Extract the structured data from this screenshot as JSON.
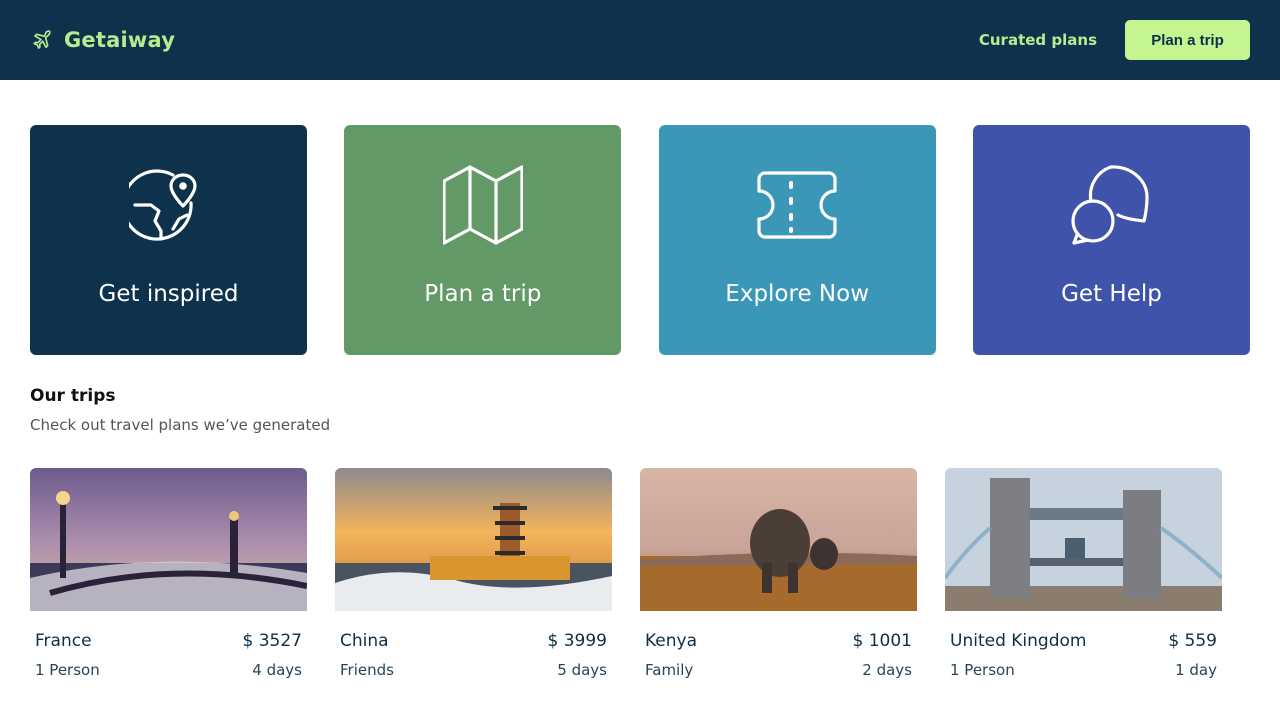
{
  "header": {
    "brand": "Getaiway",
    "nav_link": "Curated plans",
    "cta": "Plan a trip",
    "logo_icon": "airplane-icon"
  },
  "tiles": [
    {
      "label": "Get inspired",
      "icon": "globe-pin-icon",
      "color": "#0e324b"
    },
    {
      "label": "Plan a trip",
      "icon": "map-icon",
      "color": "#629966"
    },
    {
      "label": "Explore Now",
      "icon": "ticket-icon",
      "color": "#3b97b8"
    },
    {
      "label": "Get Help",
      "icon": "chat-bubbles-icon",
      "color": "#3f53ab"
    }
  ],
  "trips_section": {
    "title": "Our trips",
    "subtitle": "Check out travel plans we’ve generated"
  },
  "trips": [
    {
      "country": "France",
      "price": "$ 3527",
      "group": "1 Person",
      "duration": "4 days"
    },
    {
      "country": "China",
      "price": "$ 3999",
      "group": "Friends",
      "duration": "5 days"
    },
    {
      "country": "Kenya",
      "price": "$ 1001",
      "group": "Family",
      "duration": "2 days"
    },
    {
      "country": "United Kingdom",
      "price": "$ 559",
      "group": "1 Person",
      "duration": "1 day"
    }
  ]
}
